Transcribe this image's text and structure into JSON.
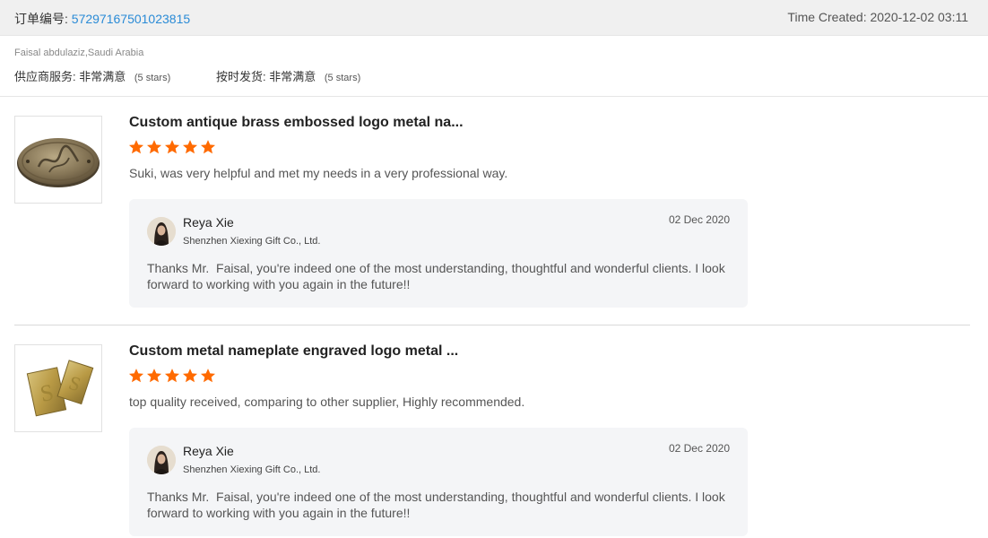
{
  "order": {
    "label": "订单编号:",
    "number": "57297167501023815",
    "time_created": "Time Created: 2020-12-02 03:11"
  },
  "buyer": {
    "name": "Faisal abdulaziz,Saudi Arabia",
    "ratings": [
      {
        "label": "供应商服务:",
        "value": "非常满意",
        "note": "(5 stars)"
      },
      {
        "label": "按时发货:",
        "value": "非常满意",
        "note": "(5 stars)"
      }
    ]
  },
  "reviews": [
    {
      "product_title": "Custom antique brass embossed logo metal na...",
      "stars": 5,
      "text": "Suki, was very helpful and met my needs in a very professional way.",
      "reply": {
        "name": "Reya Xie",
        "company": "Shenzhen Xiexing Gift Co., Ltd.",
        "date": "02 Dec 2020",
        "text": "Thanks Mr.  Faisal, you're indeed one of the most understanding, thoughtful and wonderful clients. I look forward to working with you again in the future!!"
      }
    },
    {
      "product_title": "Custom metal nameplate engraved logo metal ...",
      "stars": 5,
      "text": "top quality received, comparing to other supplier, Highly recommended.",
      "reply": {
        "name": "Reya Xie",
        "company": "Shenzhen Xiexing Gift Co., Ltd.",
        "date": "02 Dec 2020",
        "text": "Thanks Mr.  Faisal, you're indeed one of the most understanding, thoughtful and wonderful clients. I look forward to working with you again in the future!!"
      }
    }
  ],
  "colors": {
    "star": "#ff6a00",
    "link": "#2a8bd6",
    "header_bg": "#f0f0f0",
    "reply_bg": "#f4f5f7"
  },
  "icons": {
    "star": "star-icon",
    "product_1": "brass-oval-nameplate-image",
    "product_2": "gold-rectangular-nameplates-image",
    "avatar": "user-avatar"
  }
}
